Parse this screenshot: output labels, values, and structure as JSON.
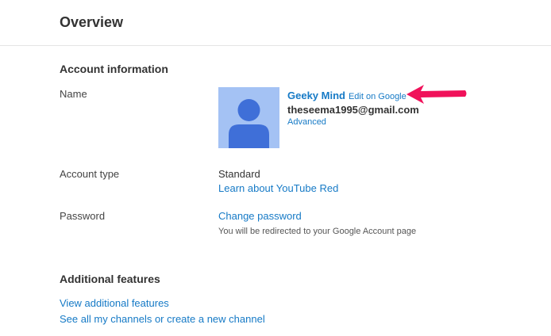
{
  "header": {
    "title": "Overview"
  },
  "account_info": {
    "title": "Account information",
    "name_label": "Name",
    "display_name": "Geeky Mind",
    "edit_link": "Edit on Google",
    "email": "theseema1995@gmail.com",
    "advanced_link": "Advanced",
    "account_type_label": "Account type",
    "account_type_value": "Standard",
    "learn_link": "Learn about YouTube Red",
    "password_label": "Password",
    "change_password_link": "Change password",
    "redirect_note": "You will be redirected to your Google Account page"
  },
  "additional": {
    "title": "Additional features",
    "view_link": "View additional features",
    "channels_link": "See all my channels or create a new channel"
  },
  "colors": {
    "link": "#167ac6",
    "avatar_bg": "#a4c2f4",
    "avatar_figure": "#3f6fd8",
    "arrow": "#f0125a"
  }
}
